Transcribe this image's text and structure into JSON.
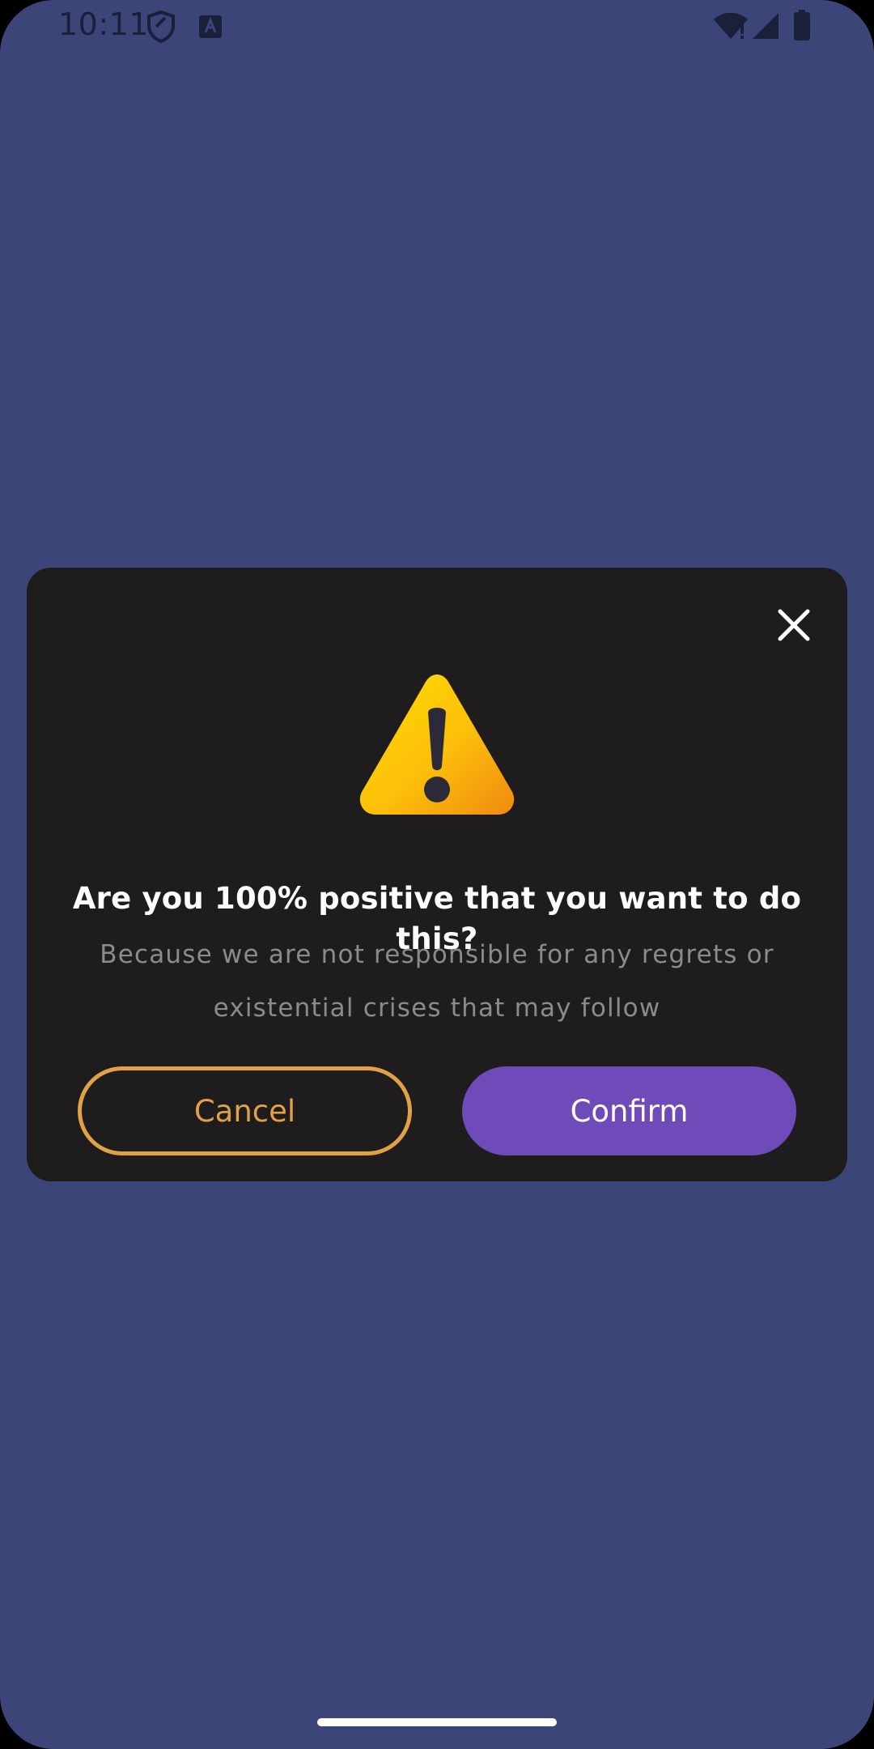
{
  "status_bar": {
    "time": "10:11",
    "icons": [
      "shield-icon",
      "a-badge-icon",
      "wifi-icon",
      "signal-icon",
      "battery-icon"
    ]
  },
  "dialog": {
    "title": "Are you 100% positive that you want to do this?",
    "message": "Because we are not responsible for any regrets or existential crises that may follow",
    "cancel_label": "Cancel",
    "confirm_label": "Confirm",
    "icons": [
      "close-icon",
      "warning-icon"
    ]
  },
  "colors": {
    "background": "#3b4577",
    "dialog": "#1e1c1d",
    "cancel_accent": "#e1a145",
    "confirm": "#6e4bb8",
    "warning_yellow": "#ffcc00",
    "warning_orange": "#f0900f"
  }
}
